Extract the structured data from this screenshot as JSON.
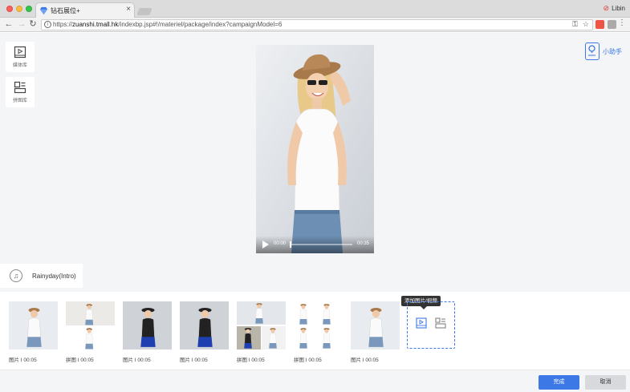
{
  "browser": {
    "tab_title": "钻石展位+",
    "tab_close": "×",
    "profile_name": "Libin",
    "url_host": "zuanshi.tmall.hk",
    "url_prefix": "https://",
    "url_path": "/indexbp.jsp#!/materiel/package/index?campaignModel=6"
  },
  "sidebar": {
    "media_label": "媒体库",
    "collage_label": "拼图库"
  },
  "helper": {
    "label": "小助手"
  },
  "player": {
    "current_time": "00:00",
    "duration": "00:35",
    "progress": 0
  },
  "music": {
    "title": "Rainyday(Intro)",
    "icon": "music-note-icon"
  },
  "clips": [
    {
      "label": "图片 I 00:05",
      "kind": "single-white"
    },
    {
      "label": "拼图 I 00:05",
      "kind": "collage-2"
    },
    {
      "label": "图片 I 00:05",
      "kind": "single-dark"
    },
    {
      "label": "图片 I 00:05",
      "kind": "single-dark"
    },
    {
      "label": "拼图 I 00:05",
      "kind": "collage-3"
    },
    {
      "label": "拼图 I 00:05",
      "kind": "collage-4"
    },
    {
      "label": "图片 I 00:05",
      "kind": "single-white"
    }
  ],
  "add_media": {
    "tooltip": "添加图片/视频"
  },
  "footer": {
    "done_label": "完成",
    "cancel_label": "取消"
  },
  "colors": {
    "accent": "#3c78e6",
    "panel_bg": "#f4f5f7"
  }
}
